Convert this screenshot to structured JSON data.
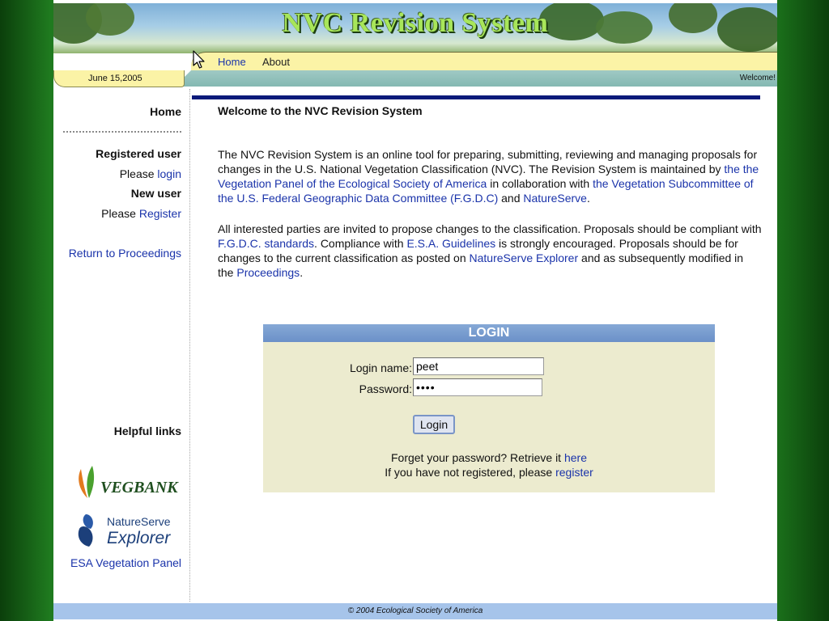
{
  "header": {
    "title": "NVC Revision System"
  },
  "nav": {
    "home": "Home",
    "about": "About"
  },
  "date_bar": {
    "date": "June 15,2005",
    "welcome": "Welcome!"
  },
  "sidebar": {
    "home": "Home",
    "registered_user": "Registered user",
    "please_1": "Please",
    "login_link": "login",
    "new_user": "New user",
    "please_2": "Please",
    "register_link": "Register",
    "return_link": "Return to Proceedings",
    "helpful_links": "Helpful links",
    "vegbank_logo_text": "VEGBANK",
    "natureserve_logo_line1": "NatureServe",
    "natureserve_logo_line2": "Explorer",
    "esa_link": "ESA Vegetation Panel"
  },
  "main": {
    "title": "Welcome to the NVC Revision System",
    "p1": {
      "t1": "The NVC Revision System is an online tool for preparing, submitting, reviewing and managing proposals for changes in the U.S. National Vegetation Classification (NVC). The Revision System is maintained by ",
      "l1": "the the Vegetation Panel of the Ecological Society of America",
      "t2": " in collaboration with ",
      "l2": "the Vegetation Subcommittee of the U.S. Federal Geographic Data Committee (F.G.D.C)",
      "t3": " and ",
      "l3": "NatureServe",
      "t4": "."
    },
    "p2": {
      "t1": "All interested parties are invited to propose changes to the classification. Proposals should be compliant with ",
      "l1": "F.G.D.C. standards",
      "t2": ". Compliance with ",
      "l2": "E.S.A. Guidelines",
      "t3": " is strongly encouraged. Proposals should be for changes to the current classification as posted on ",
      "l3": "NatureServe Explorer",
      "t4": " and as subsequently modified in the ",
      "l4": "Proceedings",
      "t5": "."
    }
  },
  "login": {
    "header": "LOGIN",
    "name_label": "Login name:",
    "name_value": "peet",
    "password_label": "Password:",
    "password_value": "••••",
    "button": "Login",
    "forgot_text": "Forget your password? Retrieve it ",
    "forgot_link": "here",
    "register_text": "If you have not registered, please ",
    "register_link": "register"
  },
  "footer": {
    "text": "© 2004 Ecological Society of America"
  },
  "colors": {
    "link": "#1a33aa",
    "title_green": "#a8e65a",
    "nav_yellow": "#fbf3a6",
    "login_header": "#6b90c8",
    "login_bg": "#ecebcf",
    "footer_bg": "#a6c4ea",
    "rule_navy": "#0a1a7a"
  },
  "icons": {
    "cursor": "arrow-cursor-icon"
  }
}
